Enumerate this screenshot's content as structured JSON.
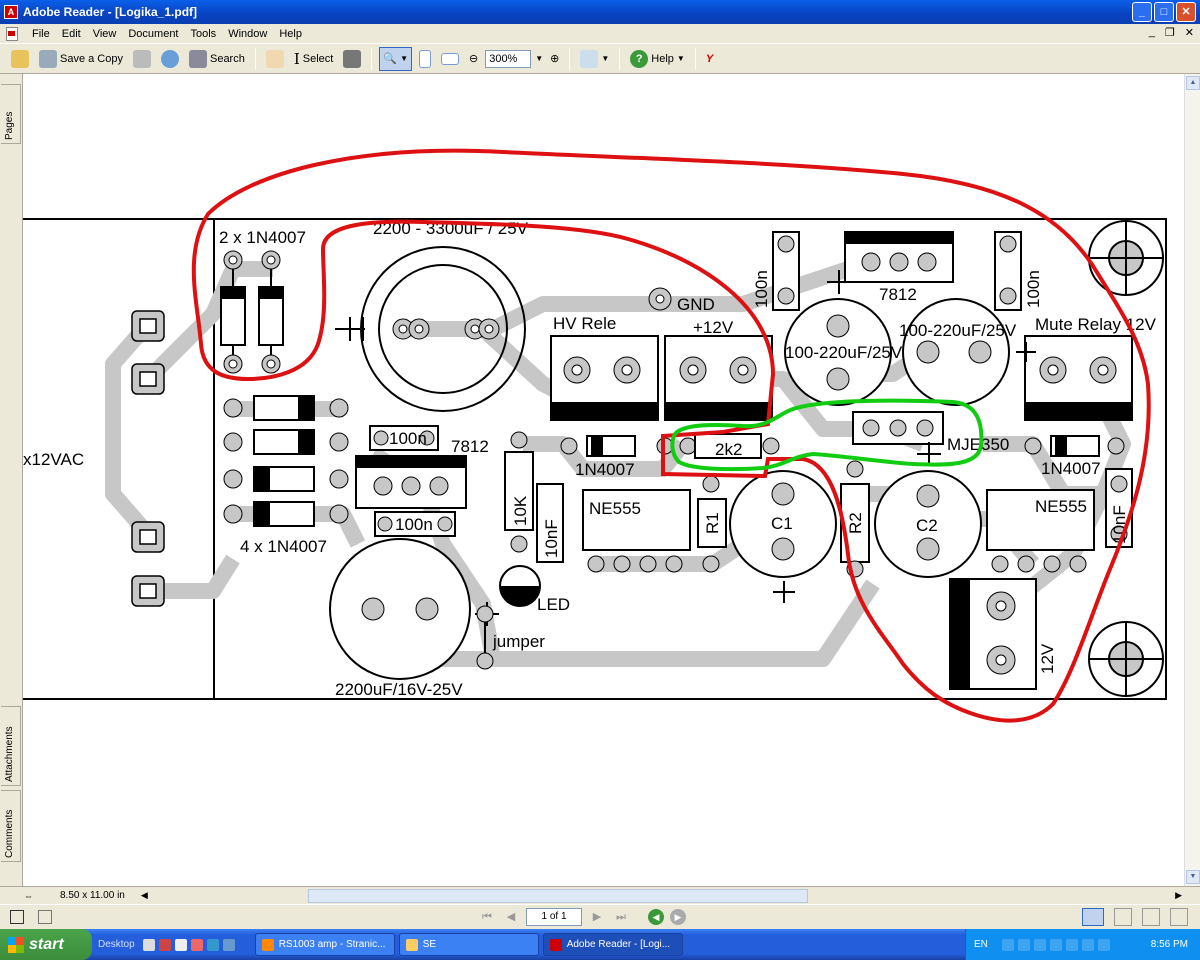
{
  "window": {
    "title": "Adobe Reader - [Logika_1.pdf]"
  },
  "menu": [
    "File",
    "Edit",
    "View",
    "Document",
    "Tools",
    "Window",
    "Help"
  ],
  "toolbar": {
    "save_copy": "Save a Copy",
    "search": "Search",
    "select": "Select",
    "zoom": "300%",
    "help": "Help"
  },
  "side_tabs": {
    "pages": "Pages",
    "attachments": "Attachments",
    "comments": "Comments"
  },
  "status": {
    "page_size": "8.50 x 11.00 in"
  },
  "nav": {
    "page": "1 of 1"
  },
  "pcb": {
    "labels": {
      "d2": "2 x 1N4007",
      "cap_top": "2200 - 3300uF / 25V",
      "gnd": "GND",
      "hv": "HV Rele",
      "plus12": "+12V",
      "n100_a": "100n",
      "n7812_top": "7812",
      "n100_b": "100n",
      "cap_mid": "100-220uF/25V",
      "cap_right": "100-220uF/25V",
      "mute": "Mute Relay 12V",
      "vac": "x12VAC",
      "n100_c": "100n",
      "n7812_mid": "7812",
      "d_mid": "1N4007",
      "r2k2": "2k2",
      "mje": "MJE350",
      "d_right": "1N4007",
      "k10": "10K",
      "nf10_a": "10nF",
      "ne555_a": "NE555",
      "r1": "R1",
      "c1": "C1",
      "r2": "R2",
      "c2": "C2",
      "ne555_b": "NE555",
      "nf10_b": "10nF",
      "d4": "4 x 1N4007",
      "n100_d": "100n",
      "led": "LED",
      "jumper": "jumper",
      "cap_bot": "2200uF/16V-25V",
      "v12": "12V"
    }
  },
  "taskbar": {
    "start": "start",
    "desktop": "Desktop",
    "tasks": [
      "RS1003 amp - Stranic...",
      "SE",
      "Adobe Reader - [Logi..."
    ],
    "lang": "EN",
    "clock": "8:56 PM"
  }
}
